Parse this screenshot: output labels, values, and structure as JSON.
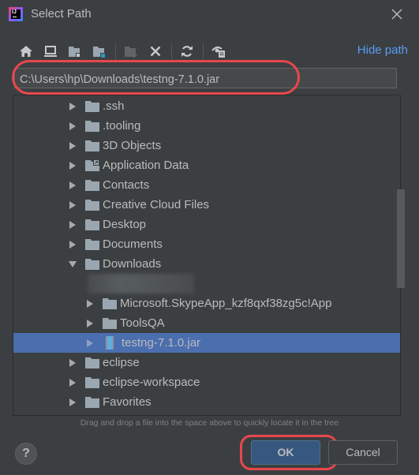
{
  "window": {
    "title": "Select Path",
    "app_icon": "intellij-idea-icon",
    "app_icon_text": "IJ"
  },
  "toolbar": {
    "icons": [
      {
        "name": "home-icon",
        "enabled": true
      },
      {
        "name": "desktop-icon",
        "enabled": true
      },
      {
        "name": "project-folder-icon",
        "enabled": true
      },
      {
        "name": "module-folder-icon",
        "enabled": true
      },
      {
        "name": "new-folder-icon",
        "enabled": false
      },
      {
        "name": "delete-icon",
        "enabled": true
      },
      {
        "name": "refresh-icon",
        "enabled": true
      },
      {
        "name": "show-hidden-icon",
        "enabled": true
      }
    ],
    "hide_path_label": "Hide path"
  },
  "path_field": {
    "value": "C:\\Users\\hp\\Downloads\\testng-7.1.0.jar"
  },
  "tree": {
    "rows": [
      {
        "label": ".ssh",
        "type": "folder",
        "level": 0,
        "expanded": false
      },
      {
        "label": ".tooling",
        "type": "folder",
        "level": 0,
        "expanded": false
      },
      {
        "label": "3D Objects",
        "type": "folder",
        "level": 0,
        "expanded": false
      },
      {
        "label": "Application Data",
        "type": "folder-link",
        "level": 0,
        "expanded": false
      },
      {
        "label": "Contacts",
        "type": "folder",
        "level": 0,
        "expanded": false
      },
      {
        "label": "Creative Cloud Files",
        "type": "folder",
        "level": 0,
        "expanded": false
      },
      {
        "label": "Desktop",
        "type": "folder",
        "level": 0,
        "expanded": false
      },
      {
        "label": "Documents",
        "type": "folder",
        "level": 0,
        "expanded": false
      },
      {
        "label": "Downloads",
        "type": "folder",
        "level": 0,
        "expanded": true
      },
      {
        "label": "",
        "type": "redacted",
        "level": 1,
        "expanded": false
      },
      {
        "label": "Microsoft.SkypeApp_kzf8qxf38zg5c!App",
        "type": "folder",
        "level": 1,
        "expanded": false
      },
      {
        "label": "ToolsQA",
        "type": "folder",
        "level": 1,
        "expanded": false
      },
      {
        "label": "testng-7.1.0.jar",
        "type": "jar",
        "level": 1,
        "expanded": false,
        "selected": true
      },
      {
        "label": "eclipse",
        "type": "folder",
        "level": 0,
        "expanded": false
      },
      {
        "label": "eclipse-workspace",
        "type": "folder",
        "level": 0,
        "expanded": false
      },
      {
        "label": "Favorites",
        "type": "folder",
        "level": 0,
        "expanded": false
      }
    ]
  },
  "hint": "Drag and drop a file into the space above to quickly locate it in the tree",
  "footer": {
    "help_label": "?",
    "ok_label": "OK",
    "cancel_label": "Cancel"
  },
  "colors": {
    "background": "#3c3f41",
    "selection": "#4b6eaf",
    "link": "#589df6",
    "ok_button": "#365880",
    "annotation": "#e8474d"
  }
}
